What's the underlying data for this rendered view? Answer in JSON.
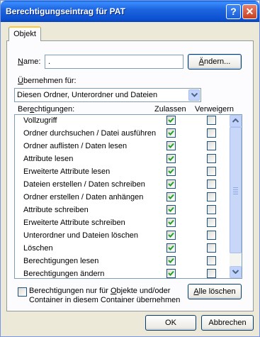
{
  "window": {
    "title": "Berechtigungseintrag für PAT",
    "help_label": "?",
    "close_label": "✕"
  },
  "tab": {
    "label": "Objekt"
  },
  "name_field": {
    "label_prefix": "N",
    "label_rest": "ame:",
    "value": ".",
    "change_button": {
      "u": "Ä",
      "rest": "ndern..."
    }
  },
  "apply": {
    "label_prefix": "Ü",
    "label_rest": "bernehmen für:",
    "selected": "Diesen Ordner, Unterordner und Dateien"
  },
  "permissions": {
    "label_pre": "Ber",
    "label_u": "e",
    "label_post": "chtigungen:",
    "col_allow": "Zulassen",
    "col_deny": "Verweigern",
    "rows": [
      {
        "name": "Vollzugriff",
        "allow": true,
        "deny": false
      },
      {
        "name": "Ordner durchsuchen / Datei ausführen",
        "allow": true,
        "deny": false
      },
      {
        "name": "Ordner auflisten / Daten lesen",
        "allow": true,
        "deny": false
      },
      {
        "name": "Attribute lesen",
        "allow": true,
        "deny": false
      },
      {
        "name": "Erweiterte Attribute lesen",
        "allow": true,
        "deny": false
      },
      {
        "name": "Dateien erstellen / Daten schreiben",
        "allow": true,
        "deny": false
      },
      {
        "name": "Ordner erstellen / Daten anhängen",
        "allow": true,
        "deny": false
      },
      {
        "name": "Attribute schreiben",
        "allow": true,
        "deny": false
      },
      {
        "name": "Erweiterte Attribute schreiben",
        "allow": true,
        "deny": false
      },
      {
        "name": "Unterordner und Dateien löschen",
        "allow": true,
        "deny": false
      },
      {
        "name": "Löschen",
        "allow": true,
        "deny": false
      },
      {
        "name": "Berechtigungen lesen",
        "allow": true,
        "deny": false
      },
      {
        "name": "Berechtigungen ändern",
        "allow": true,
        "deny": false
      }
    ]
  },
  "inherit_option": {
    "line1_pre": "Berechtigungen nur für ",
    "line1_u": "O",
    "line1_post": "bjekte und/oder",
    "line2": "Container in diesem Container übernehmen",
    "checked": false
  },
  "clear_button": {
    "u": "A",
    "rest": "lle löschen"
  },
  "ok_button": "OK",
  "cancel_button": "Abbrechen",
  "colors": {
    "title_blue": "#0b4fcf",
    "face": "#ece9d8",
    "check_green": "#21a121",
    "tab_accent": "#ffc83c"
  }
}
